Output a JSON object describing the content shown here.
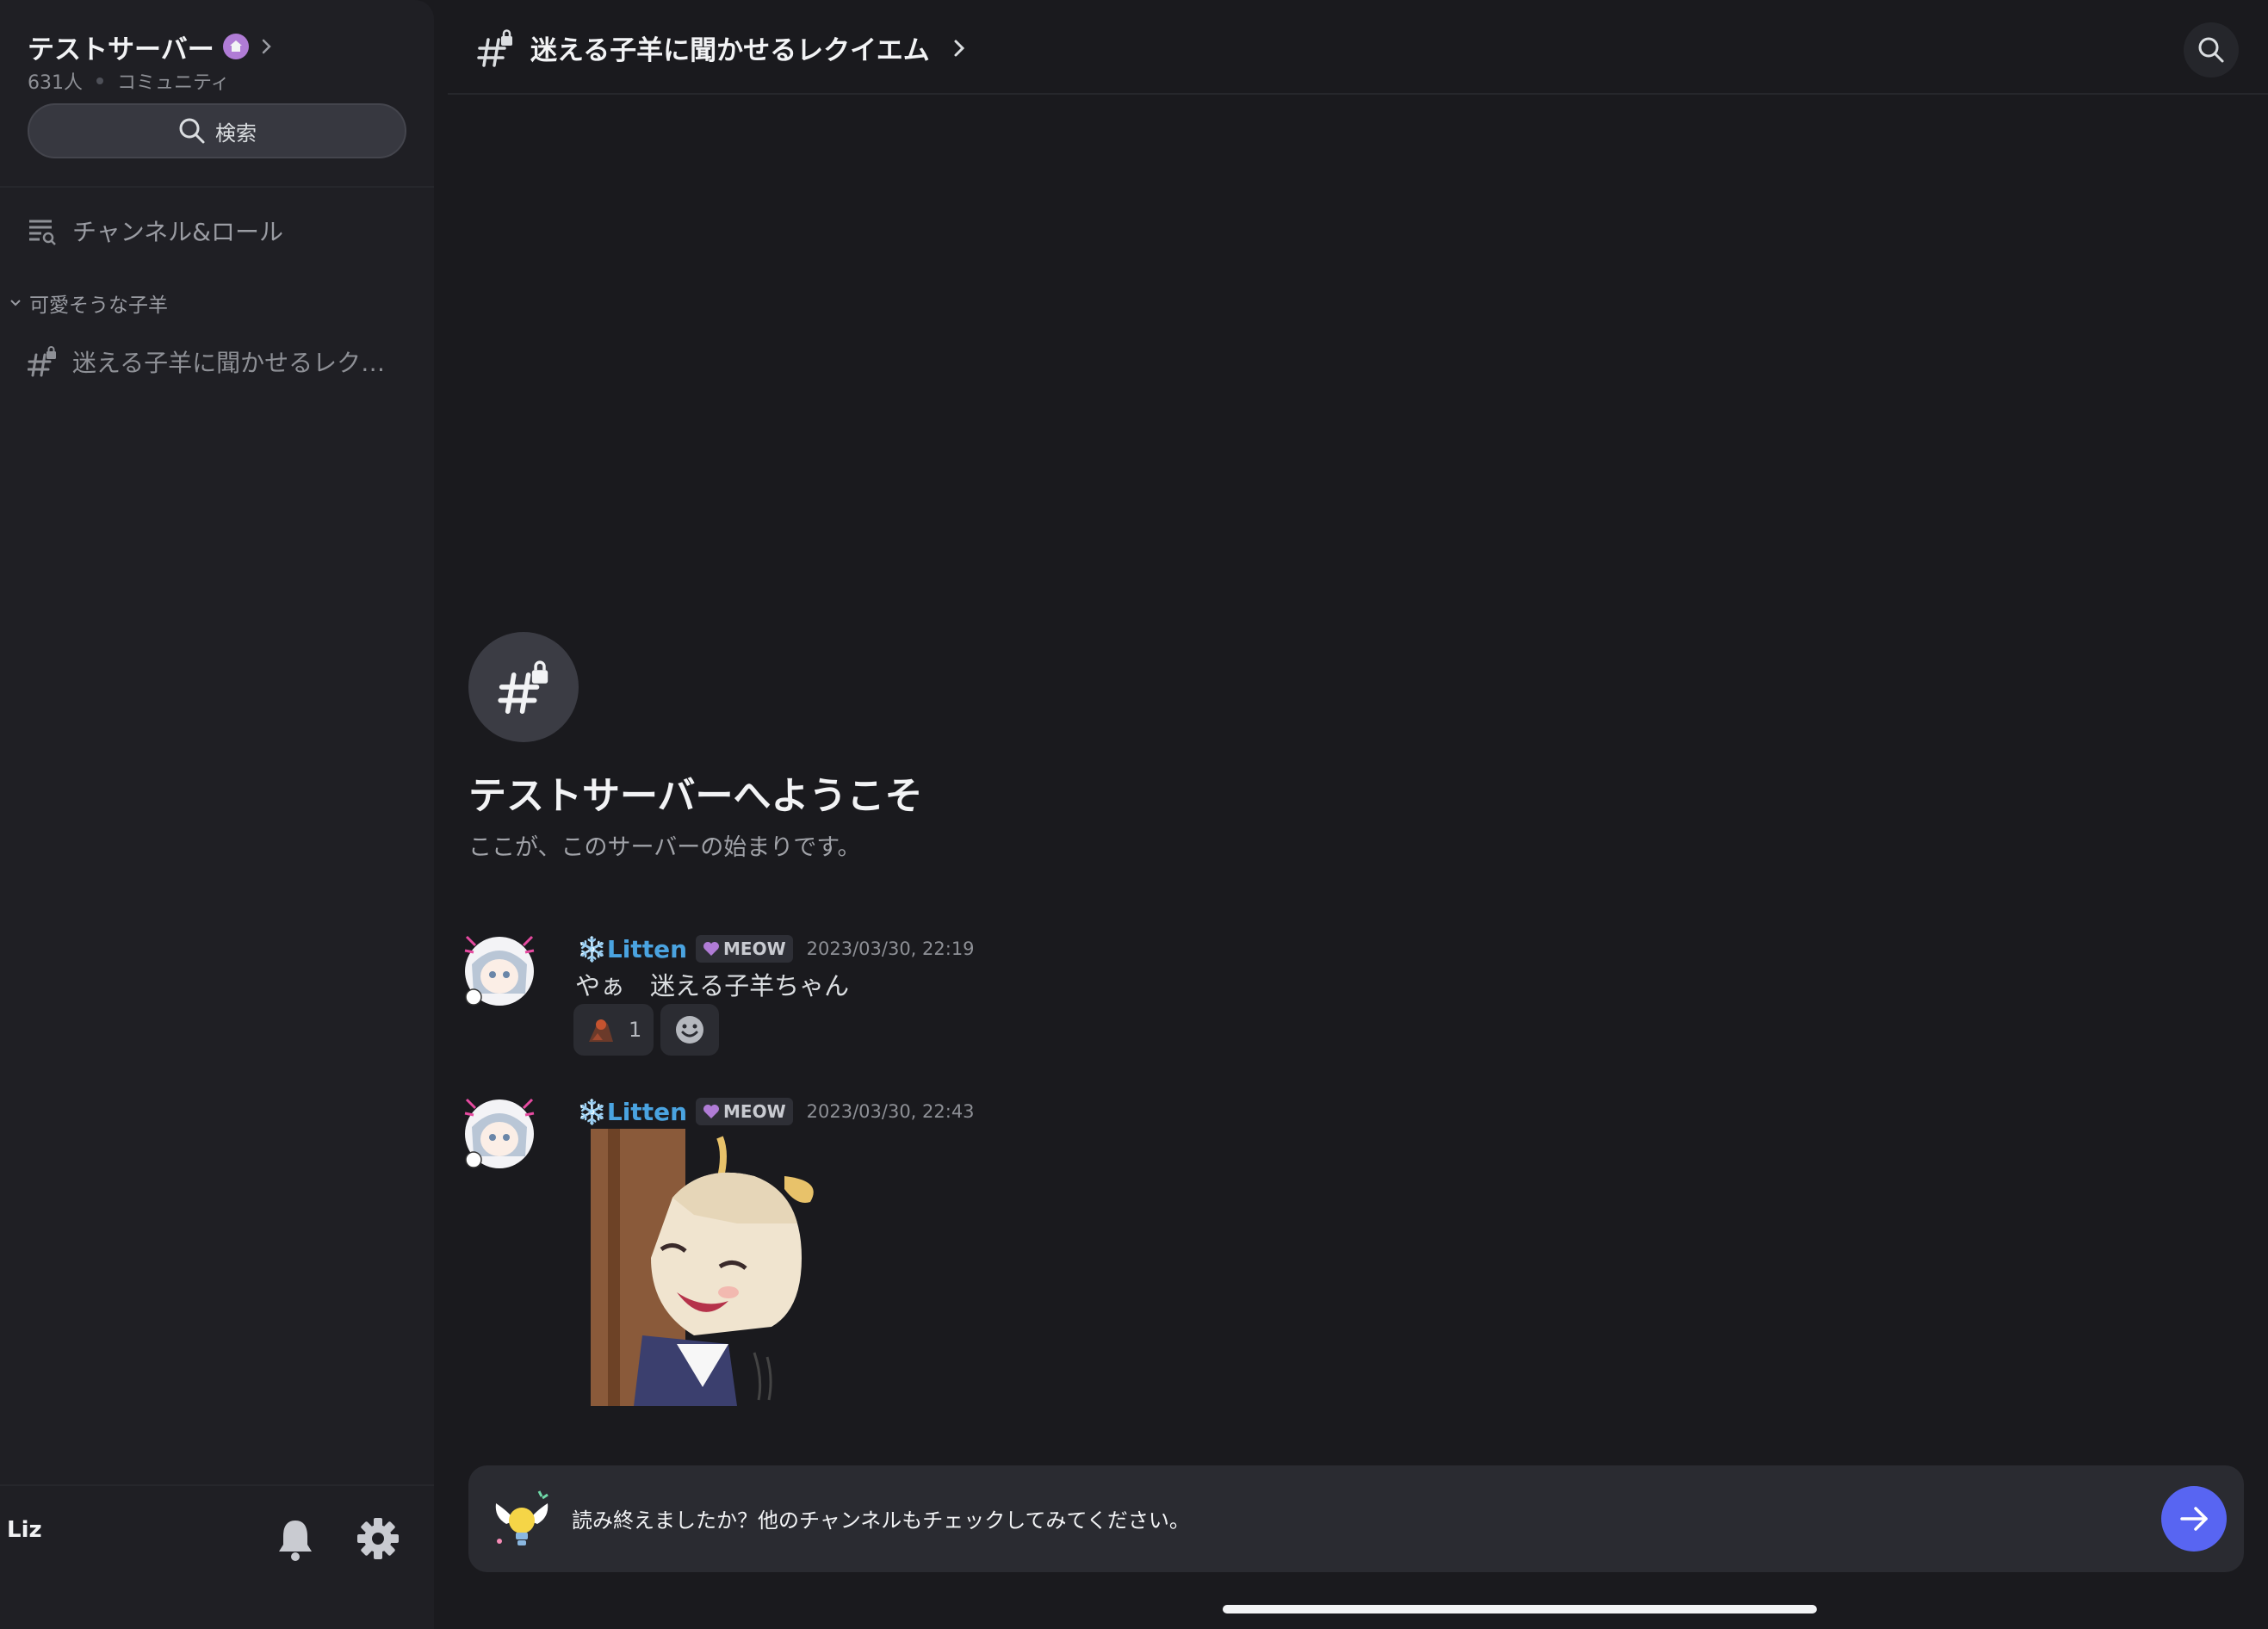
{
  "server": {
    "name": "テストサーバー",
    "member_count": "631人",
    "type": "コミュニティ",
    "badge_icon": "server-boost-flower-icon"
  },
  "sidebar": {
    "search_label": "検索",
    "channels_roles_label": "チャンネル&ロール",
    "category_label": "可愛そうな子羊",
    "channel_label": "迷える子羊に聞かせるレク…"
  },
  "user": {
    "name": "Liz"
  },
  "header": {
    "channel_title": "迷える子羊に聞かせるレクイエム"
  },
  "welcome": {
    "title": "テストサーバーへようこそ",
    "subtitle": "ここが、このサーバーの始まりです。"
  },
  "messages": [
    {
      "author": "❄️Litten",
      "role": "MEOW",
      "timestamp": "2023/03/30, 22:19",
      "text": "やぁ　迷える子羊ちゃん",
      "reaction_count": "1"
    },
    {
      "author": "❄️Litten",
      "role": "MEOW",
      "timestamp": "2023/03/30, 22:43",
      "attachment": "sticker"
    }
  ],
  "composer": {
    "prompt": "読み終えましたか？他のチャンネルもチェックしてみてください。"
  },
  "colors": {
    "accent": "#5865f2",
    "author_name": "#4aa3e0",
    "badge": "#b07cd6"
  }
}
